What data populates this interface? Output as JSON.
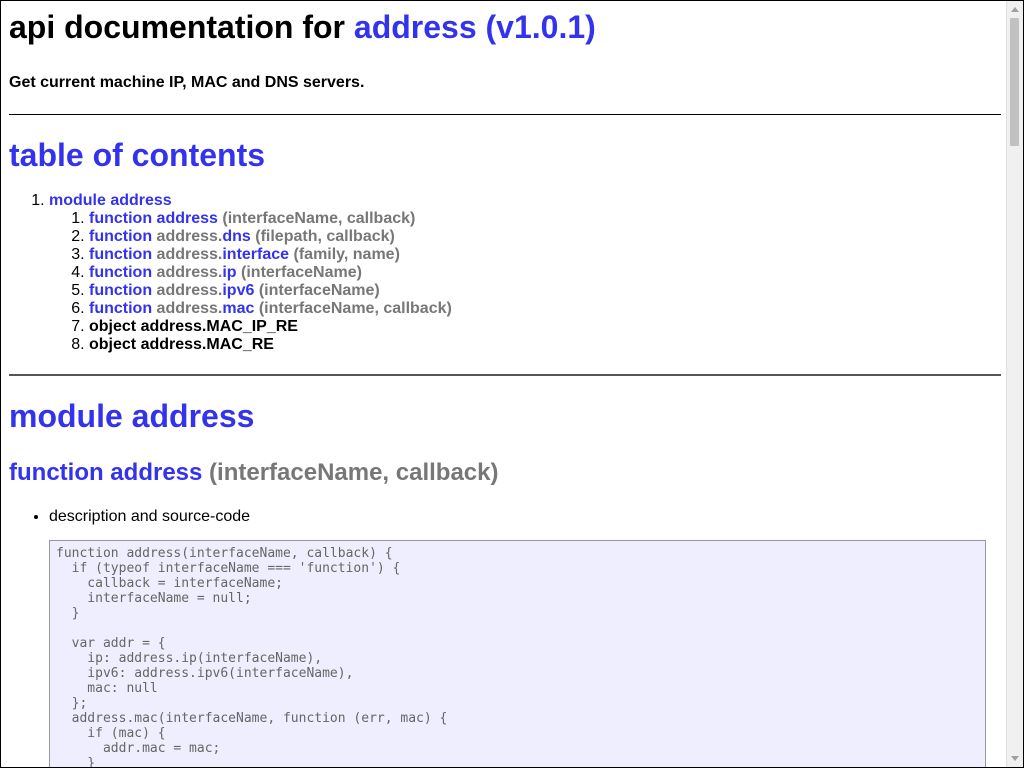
{
  "header": {
    "title_prefix": "api documentation for ",
    "title_link": "address (v1.0.1)",
    "subtitle": "Get current machine IP, MAC and DNS servers."
  },
  "toc": {
    "heading": "table of contents",
    "module_label": "module address",
    "items": [
      {
        "kw": "function",
        "prefix": "",
        "name": "address",
        "args": " (interfaceName, callback)"
      },
      {
        "kw": "function",
        "prefix": " address.",
        "name": "dns",
        "args": " (filepath, callback)"
      },
      {
        "kw": "function",
        "prefix": " address.",
        "name": "interface",
        "args": " (family, name)"
      },
      {
        "kw": "function",
        "prefix": " address.",
        "name": "ip",
        "args": " (interfaceName)"
      },
      {
        "kw": "function",
        "prefix": " address.",
        "name": "ipv6",
        "args": " (interfaceName)"
      },
      {
        "kw": "function",
        "prefix": " address.",
        "name": "mac",
        "args": " (interfaceName, callback)"
      },
      {
        "text": "object address.MAC_IP_RE"
      },
      {
        "text": "object address.MAC_RE"
      }
    ]
  },
  "module": {
    "heading": "module address",
    "function_heading": "function address",
    "function_args": " (interfaceName, callback)",
    "bullet": "description and source-code",
    "code": "function address(interfaceName, callback) {\n  if (typeof interfaceName === 'function') {\n    callback = interfaceName;\n    interfaceName = null;\n  }\n\n  var addr = {\n    ip: address.ip(interfaceName),\n    ipv6: address.ipv6(interfaceName),\n    mac: null\n  };\n  address.mac(interfaceName, function (err, mac) {\n    if (mac) {\n      addr.mac = mac;\n    }\n    callback(err, addr);\n  });\n}"
  },
  "colors": {
    "link": "#3333ee",
    "muted": "#777777",
    "code_bg": "#eeeeff",
    "code_text": "#666666"
  }
}
